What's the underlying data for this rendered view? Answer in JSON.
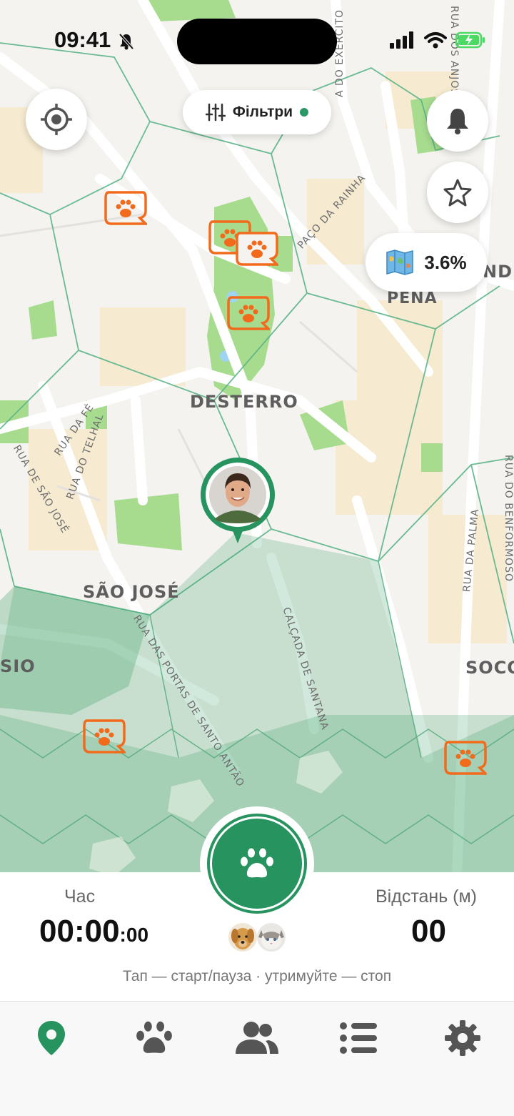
{
  "status_bar": {
    "time": "09:41"
  },
  "map": {
    "districts": [
      "DESTERRO",
      "PENA",
      "SÃO JOSÉ",
      "SIO",
      "SOCO",
      "NDE"
    ],
    "streets": [
      "RUA DA FÉ",
      "RUA DO TELHAL",
      "RUA DE SÃO JOSÉ",
      "PAÇO DA RAINHA",
      "CALÇADA DE SANTANA",
      "RUA DAS PORTAS DE SANTO ANTÃO",
      "RUA DA PALMA",
      "RUA DO BENFORMOSO",
      "A DO EXÉRCITO",
      "RUA DOS ANJOS"
    ]
  },
  "controls": {
    "locate_icon": "crosshair-icon",
    "filters_label": "Фільтри",
    "filters_active_color": "#2a9863",
    "notifications_icon": "bell-icon",
    "favorites_icon": "star-icon",
    "coverage_percent": "3.6%",
    "coverage_icon": "map-icon"
  },
  "tracker": {
    "time_label": "Час",
    "time_main": "00:00",
    "time_fraction": ":00",
    "distance_label": "Відстань (м)",
    "distance_value": "00",
    "hint": "Тап — старт/пауза · утримуйте — стоп",
    "start_icon": "paw-icon",
    "accent_color": "#27935e"
  },
  "tabs": [
    {
      "icon": "map-pin-icon",
      "active": true
    },
    {
      "icon": "paw-icon",
      "active": false
    },
    {
      "icon": "people-icon",
      "active": false
    },
    {
      "icon": "list-icon",
      "active": false
    },
    {
      "icon": "gear-icon",
      "active": false
    }
  ],
  "colors": {
    "marker": "#f26a1b",
    "zone": "#2e9b5e",
    "active_tab": "#27935e",
    "inactive_tab": "#555555"
  }
}
